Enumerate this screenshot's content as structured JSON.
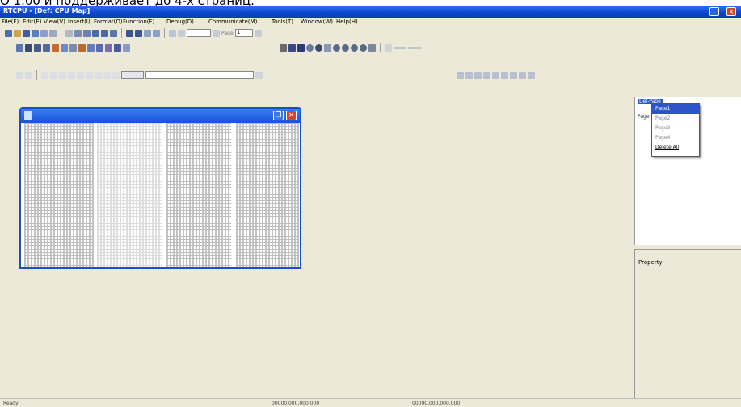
{
  "caption": "O 1.00 и поддерживает до 4-х страниц.",
  "window": {
    "title": "RTCPU - [Def: CPU Map]",
    "minimize_glyph": "_",
    "close_glyph": "×"
  },
  "menu": [
    "File(F)",
    "Edit(E)",
    "View(V)",
    "Insert(I)",
    "Format(O)",
    "Function(F)",
    "Debug(D)",
    "Communicate(M)",
    "Tools(T)",
    "Window(W)",
    "Help(H)"
  ],
  "toolbar": {
    "page_label": "Page",
    "page_value": "1"
  },
  "doc_window": {
    "restore_glyph": "❐",
    "close_glyph": "×"
  },
  "tree": {
    "root": "Def-Page",
    "child": "Page"
  },
  "popup": {
    "items": [
      "Page1",
      "Page2",
      "Page3",
      "Page4",
      "Delete All"
    ],
    "selected": 0
  },
  "lower_panel": {
    "label": "Property"
  },
  "status": {
    "left": "Ready",
    "middle": "00000,000,000,000",
    "right": "00000,000,000,000"
  },
  "colors": {
    "titlebar": "#0a45c8",
    "face": "#ece9d8",
    "close": "#d2452a"
  }
}
